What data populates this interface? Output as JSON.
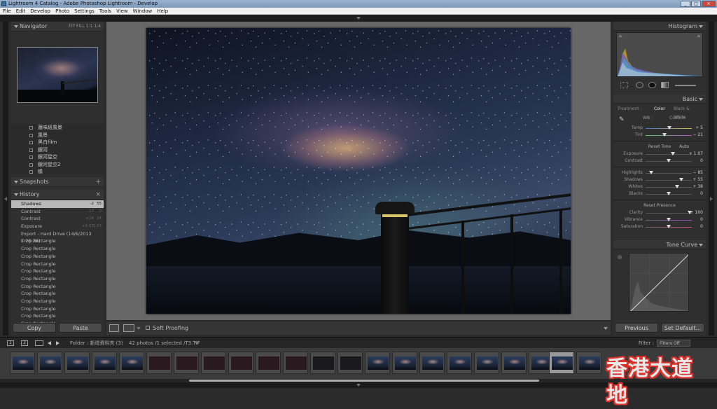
{
  "window": {
    "title": "Lightroom 4 Catalog - Adobe Photoshop Lightroom - Develop"
  },
  "menu": [
    "File",
    "Edit",
    "Develop",
    "Photo",
    "Settings",
    "Tools",
    "View",
    "Window",
    "Help"
  ],
  "navigator": {
    "title": "Navigator",
    "zoom_options": "FIT   FILL   1:1   1:4"
  },
  "collections": [
    "蓮味紐風景",
    "風景",
    "黑白film",
    "銀河",
    "銀河星空",
    "銀河星空2",
    "蝶"
  ],
  "snapshots": {
    "title": "Snapshots",
    "add": "+"
  },
  "history": {
    "title": "History",
    "close": "×",
    "items": [
      {
        "label": "Shadows",
        "v1": "-2",
        "v2": "55"
      },
      {
        "label": "Contrast",
        "v1": "-17",
        "v2": "0"
      },
      {
        "label": "Contrast",
        "v1": "+24",
        "v2": "24"
      },
      {
        "label": "Exposure",
        "v1": "+0.07",
        "v2": "1.07"
      },
      {
        "label": "Export - Hard Drive (14/6/2013 1:25:26)",
        "v1": "",
        "v2": ""
      },
      {
        "label": "Crop Rectangle",
        "v1": "",
        "v2": ""
      },
      {
        "label": "Crop Rectangle",
        "v1": "",
        "v2": ""
      },
      {
        "label": "Crop Rectangle",
        "v1": "",
        "v2": ""
      },
      {
        "label": "Crop Rectangle",
        "v1": "",
        "v2": ""
      },
      {
        "label": "Crop Rectangle",
        "v1": "",
        "v2": ""
      },
      {
        "label": "Crop Rectangle",
        "v1": "",
        "v2": ""
      },
      {
        "label": "Crop Rectangle",
        "v1": "",
        "v2": ""
      },
      {
        "label": "Crop Rectangle",
        "v1": "",
        "v2": ""
      },
      {
        "label": "Crop Rectangle",
        "v1": "",
        "v2": ""
      },
      {
        "label": "Crop Rectangle",
        "v1": "",
        "v2": ""
      },
      {
        "label": "Crop Rectangle",
        "v1": "",
        "v2": ""
      },
      {
        "label": "Crop Rectangle",
        "v1": "",
        "v2": ""
      }
    ]
  },
  "left_buttons": {
    "copy": "Copy",
    "paste": "Paste"
  },
  "toolbar": {
    "soft_proofing": "Soft Proofing"
  },
  "right": {
    "histogram_title": "Histogram",
    "basic_title": "Basic",
    "treatment": {
      "label": "Treatment :",
      "color": "Color",
      "bw": "Black & White"
    },
    "wb": {
      "label": "WB :",
      "value": "Custom"
    },
    "temp": {
      "label": "Temp",
      "value": "+ 5"
    },
    "tint": {
      "label": "Tint",
      "value": "− 21"
    },
    "reset_tone": "Reset Tone",
    "auto": "Auto",
    "exposure": {
      "label": "Exposure",
      "value": "+ 1.07"
    },
    "contrast": {
      "label": "Contrast",
      "value": "0"
    },
    "highlights": {
      "label": "Highlights",
      "value": "− 85"
    },
    "shadows": {
      "label": "Shadows",
      "value": "+ 55"
    },
    "whites": {
      "label": "Whites",
      "value": "+ 38"
    },
    "blacks": {
      "label": "Blacks",
      "value": "0"
    },
    "reset_presence": "Reset Presence",
    "clarity": {
      "label": "Clarity",
      "value": "+ 100"
    },
    "vibrance": {
      "label": "Vibrance",
      "value": "0"
    },
    "saturation": {
      "label": "Saturation",
      "value": "0"
    },
    "tone_curve_title": "Tone Curve",
    "previous": "Previous",
    "set_default": "Set Default..."
  },
  "filmbar": {
    "pages": [
      "1",
      "2"
    ],
    "folder": "Folder : 新增資料夾 (3)",
    "count": "42 photos /1 selected /T3.TIF",
    "filter_label": "Filter :",
    "filter_value": "Filters Off"
  },
  "watermark": "香港大道地",
  "colors": {
    "watermark_outline": "#e0302a",
    "selected_history": "#b9b9b9"
  }
}
